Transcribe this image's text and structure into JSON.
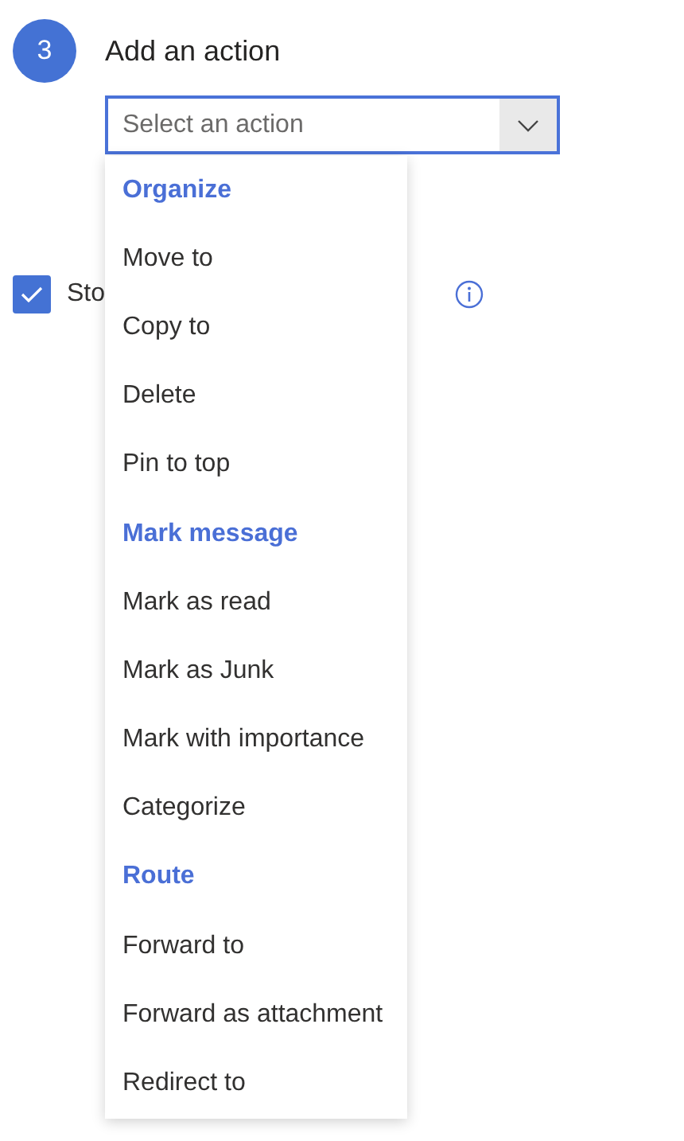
{
  "step": {
    "number": "3",
    "title": "Add an action"
  },
  "action_dropdown": {
    "placeholder": "Select an action",
    "expanded": true
  },
  "menu": [
    {
      "kind": "header",
      "label": "Organize"
    },
    {
      "kind": "item",
      "label": "Move to"
    },
    {
      "kind": "item",
      "label": "Copy to"
    },
    {
      "kind": "item",
      "label": "Delete"
    },
    {
      "kind": "item",
      "label": "Pin to top"
    },
    {
      "kind": "header",
      "label": "Mark message"
    },
    {
      "kind": "item",
      "label": "Mark as read"
    },
    {
      "kind": "item",
      "label": "Mark as Junk"
    },
    {
      "kind": "item",
      "label": "Mark with importance"
    },
    {
      "kind": "item",
      "label": "Categorize"
    },
    {
      "kind": "header",
      "label": "Route"
    },
    {
      "kind": "item",
      "label": "Forward to"
    },
    {
      "kind": "item",
      "label": "Forward as attachment"
    },
    {
      "kind": "item",
      "label": "Redirect to"
    }
  ],
  "stop_option": {
    "label": "Sto",
    "checked": true
  }
}
